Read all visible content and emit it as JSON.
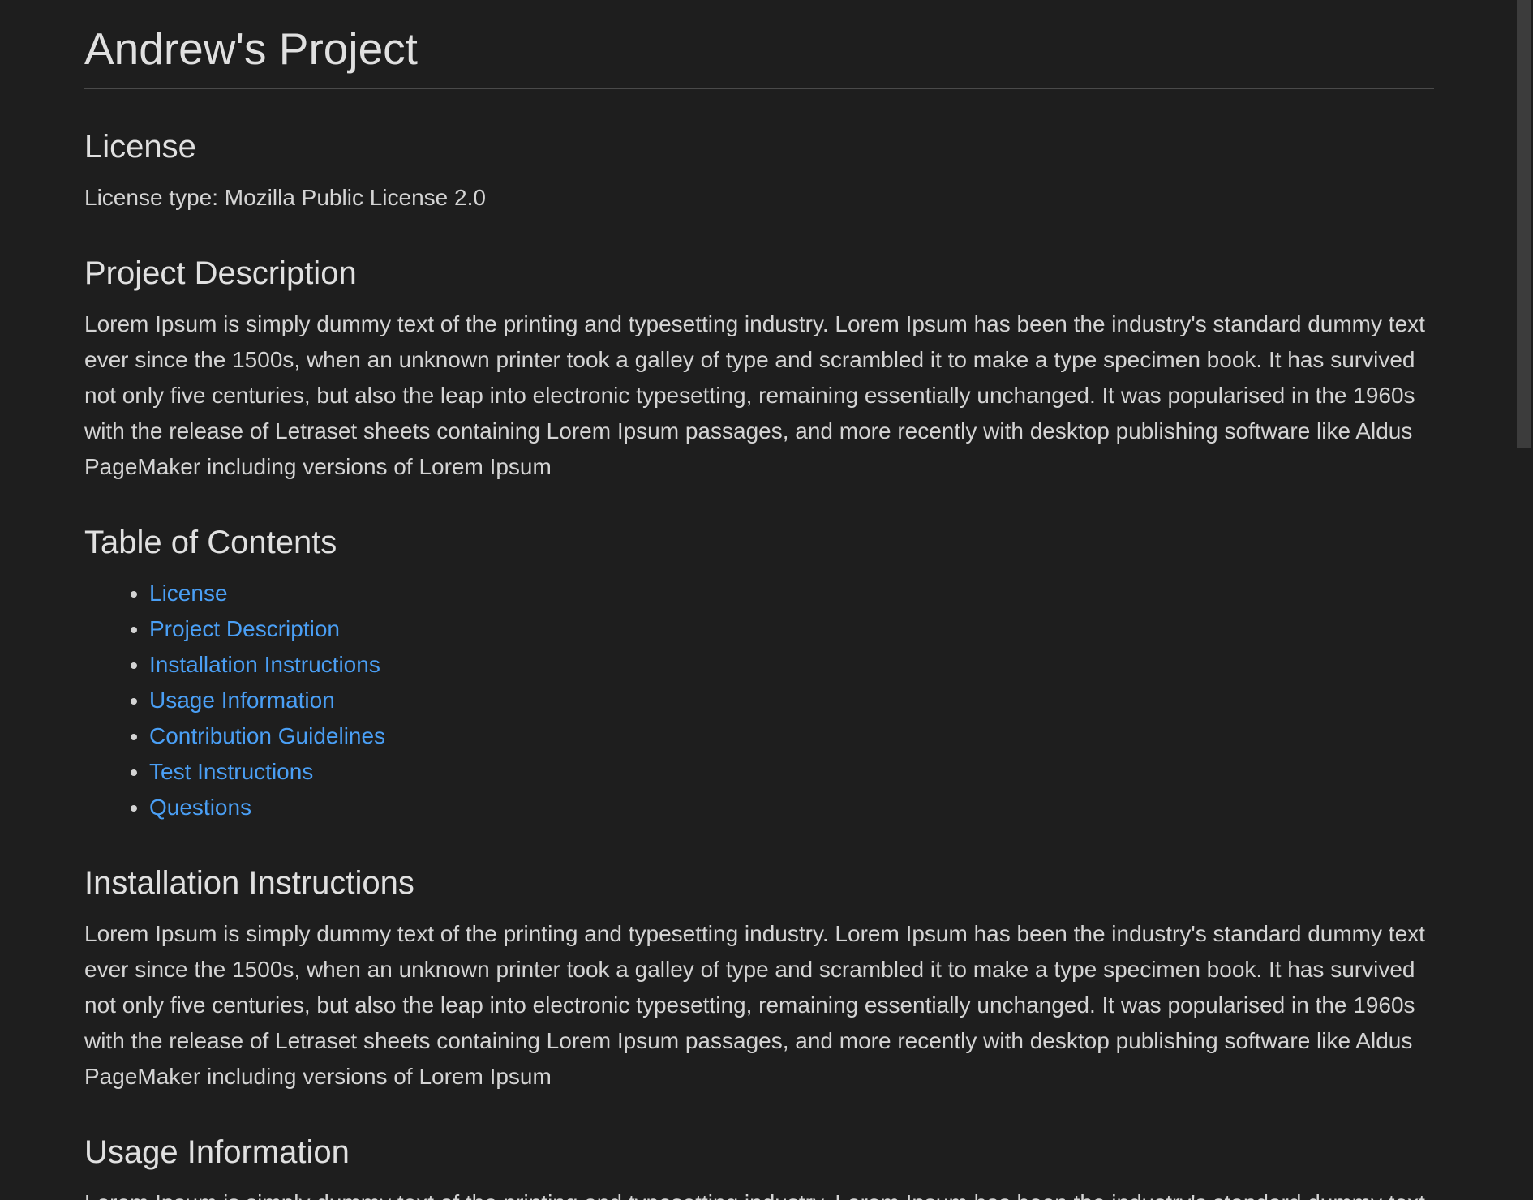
{
  "title": "Andrew's Project",
  "license": {
    "heading": "License",
    "text": "License type: Mozilla Public License 2.0"
  },
  "description": {
    "heading": "Project Description",
    "text": "Lorem Ipsum is simply dummy text of the printing and typesetting industry. Lorem Ipsum has been the industry's standard dummy text ever since the 1500s, when an unknown printer took a galley of type and scrambled it to make a type specimen book. It has survived not only five centuries, but also the leap into electronic typesetting, remaining essentially unchanged. It was popularised in the 1960s with the release of Letraset sheets containing Lorem Ipsum passages, and more recently with desktop publishing software like Aldus PageMaker including versions of Lorem Ipsum"
  },
  "toc": {
    "heading": "Table of Contents",
    "items": [
      "License",
      "Project Description",
      "Installation Instructions",
      "Usage Information",
      "Contribution Guidelines",
      "Test Instructions",
      "Questions"
    ]
  },
  "installation": {
    "heading": "Installation Instructions",
    "text": "Lorem Ipsum is simply dummy text of the printing and typesetting industry. Lorem Ipsum has been the industry's standard dummy text ever since the 1500s, when an unknown printer took a galley of type and scrambled it to make a type specimen book. It has survived not only five centuries, but also the leap into electronic typesetting, remaining essentially unchanged. It was popularised in the 1960s with the release of Letraset sheets containing Lorem Ipsum passages, and more recently with desktop publishing software like Aldus PageMaker including versions of Lorem Ipsum"
  },
  "usage": {
    "heading": "Usage Information",
    "text": "Lorem Ipsum is simply dummy text of the printing and typesetting industry. Lorem Ipsum has been the industry's standard dummy text ever since the 1500s, when an unknown printer took a galley of type and scrambled it to make a type specimen"
  },
  "colors": {
    "background": "#1e1e1e",
    "text": "#d4d4d4",
    "link": "#4a9ff5"
  }
}
